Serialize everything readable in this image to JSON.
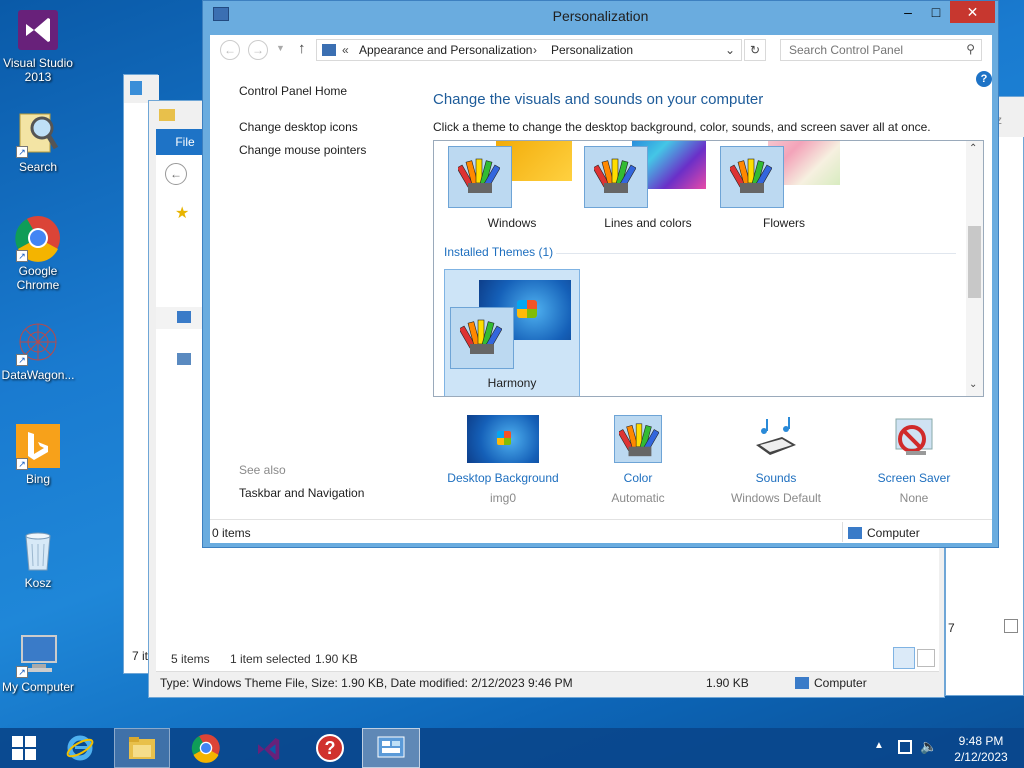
{
  "desktop": {
    "icons": [
      {
        "label": "Visual Studio 2013"
      },
      {
        "label": "Search"
      },
      {
        "label": "Google Chrome"
      },
      {
        "label": "DataWagon..."
      },
      {
        "label": "Bing"
      },
      {
        "label": "Kosz"
      },
      {
        "label": "My Computer"
      }
    ]
  },
  "explorer_back": {
    "file_tab": "File",
    "status_items": "5 items",
    "status_selected": "1 item selected",
    "status_size": "1.90 KB",
    "details": "Type: Windows Theme File, Size: 1.90 KB, Date modified: 2/12/2023 9:46 PM",
    "details_size": "1.90 KB",
    "details_location": "Computer",
    "left_status": "7 it",
    "far_left_status": "7"
  },
  "window": {
    "title": "Personalization",
    "breadcrumb_prefix": "«",
    "breadcrumb": [
      "Appearance and Personalization",
      "Personalization"
    ],
    "search_placeholder": "Search Control Panel",
    "sidebar": {
      "home": "Control Panel Home",
      "links": [
        "Change desktop icons",
        "Change mouse pointers"
      ],
      "see_also": "See also",
      "see_also_links": [
        "Taskbar and Navigation"
      ]
    },
    "heading": "Change the visuals and sounds on your computer",
    "subheading": "Click a theme to change the desktop background, color, sounds, and screen saver all at once.",
    "themes": [
      {
        "name": "Windows"
      },
      {
        "name": "Lines and colors"
      },
      {
        "name": "Flowers"
      }
    ],
    "installed_label": "Installed Themes (1)",
    "installed": [
      {
        "name": "Harmony"
      }
    ],
    "settings": [
      {
        "label": "Desktop Background",
        "value": "img0"
      },
      {
        "label": "Color",
        "value": "Automatic"
      },
      {
        "label": "Sounds",
        "value": "Windows Default"
      },
      {
        "label": "Screen Saver",
        "value": "None"
      }
    ],
    "status_items": "0 items",
    "status_location": "Computer"
  },
  "taskbar": {
    "time": "9:48 PM",
    "date": "2/12/2023"
  },
  "colors": {
    "accent": "#1e6fbf",
    "titlebar": "#6aacdf",
    "selected": "#cde4f7"
  }
}
